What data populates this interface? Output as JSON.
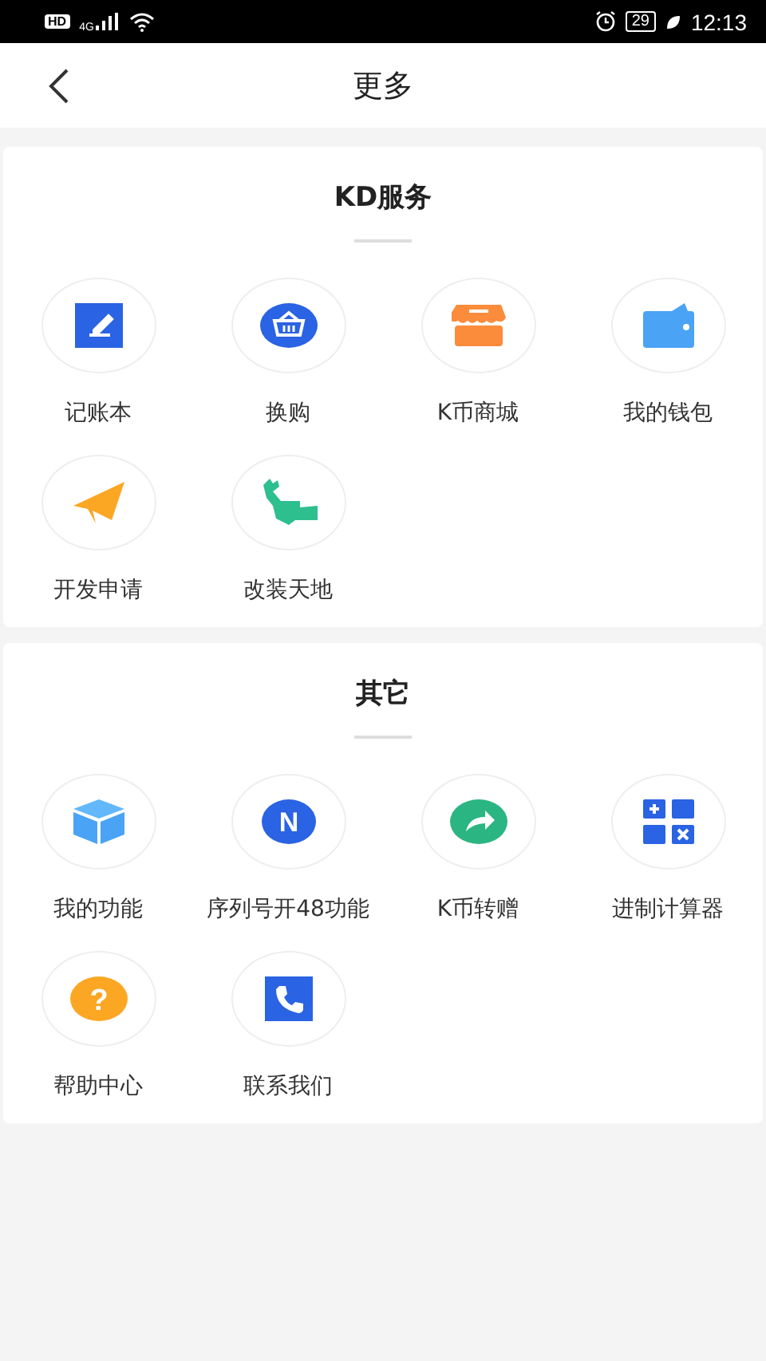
{
  "status_bar": {
    "network_badge": "HD",
    "network_type": "4G",
    "battery": "29",
    "time": "12:13"
  },
  "header": {
    "title": "更多"
  },
  "sections": [
    {
      "title": "KD服务",
      "items": [
        {
          "label": "记账本",
          "kind": "notebook"
        },
        {
          "label": "换购",
          "kind": "basket"
        },
        {
          "label": "K币商城",
          "kind": "shop"
        },
        {
          "label": "我的钱包",
          "kind": "wallet"
        },
        {
          "label": "开发申请",
          "kind": "plane"
        },
        {
          "label": "改装天地",
          "kind": "wrench"
        }
      ]
    },
    {
      "title": "其它",
      "items": [
        {
          "label": "我的功能",
          "kind": "cube"
        },
        {
          "label": "序列号开48功能",
          "kind": "letter",
          "glyph": "N"
        },
        {
          "label": "K币转赠",
          "kind": "share"
        },
        {
          "label": "进制计算器",
          "kind": "calculator"
        },
        {
          "label": "帮助中心",
          "kind": "help",
          "glyph": "?"
        },
        {
          "label": "联系我们",
          "kind": "phone"
        }
      ]
    }
  ]
}
